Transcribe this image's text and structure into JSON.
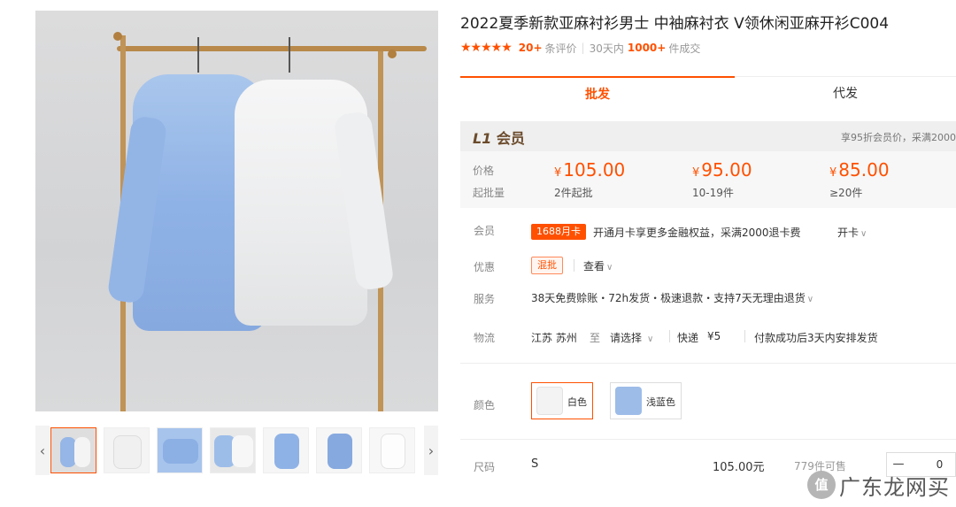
{
  "product": {
    "title": "2022夏季新款亚麻衬衫男士 中袖麻衬衣 V领休闲亚麻开衫C004",
    "stars": "★★★★★",
    "reviews_count": "20+",
    "reviews_label": "条评价",
    "sales_period": "30天内",
    "sales_count": "1000+",
    "sales_label": "件成交"
  },
  "tabs": [
    {
      "label": "批发"
    },
    {
      "label": "代发"
    }
  ],
  "member": {
    "level": "L1",
    "level_label": "会员",
    "note": "享95折会员价，采满2000"
  },
  "pricing": {
    "price_label": "价格",
    "min_batch_label": "起批量",
    "currency": "¥",
    "tiers": [
      {
        "price": "105.00",
        "qty": "2件起批"
      },
      {
        "price": "95.00",
        "qty": "10-19件"
      },
      {
        "price": "85.00",
        "qty": "≥20件"
      }
    ]
  },
  "rows": {
    "member_label": "会员",
    "member_badge": "1688月卡",
    "member_text": "开通月卡享更多金融权益，采满2000退卡费",
    "member_action": "开卡",
    "promo_label": "优惠",
    "promo_badge": "混批",
    "promo_action": "查看",
    "service_label": "服务",
    "service_text": "38天免费赊账・72h发货・极速退款・支持7天无理由退货",
    "logistics_label": "物流",
    "origin": "江苏 苏州",
    "to": "至",
    "destination": "请选择",
    "delivery": "快递",
    "delivery_fee": "¥5",
    "dispatch": "付款成功后3天内安排发货"
  },
  "colors": {
    "label": "颜色",
    "options": [
      {
        "name": "白色",
        "selected": true
      },
      {
        "name": "浅蓝色",
        "selected": false
      }
    ]
  },
  "sizes": {
    "label": "尺码",
    "items": [
      {
        "size": "S",
        "price": "105.00元",
        "stock": "779件可售",
        "quantity": "0"
      }
    ]
  },
  "watermark": {
    "logo": "值",
    "text": "广东龙网买"
  },
  "accent_color": "#ff5000"
}
